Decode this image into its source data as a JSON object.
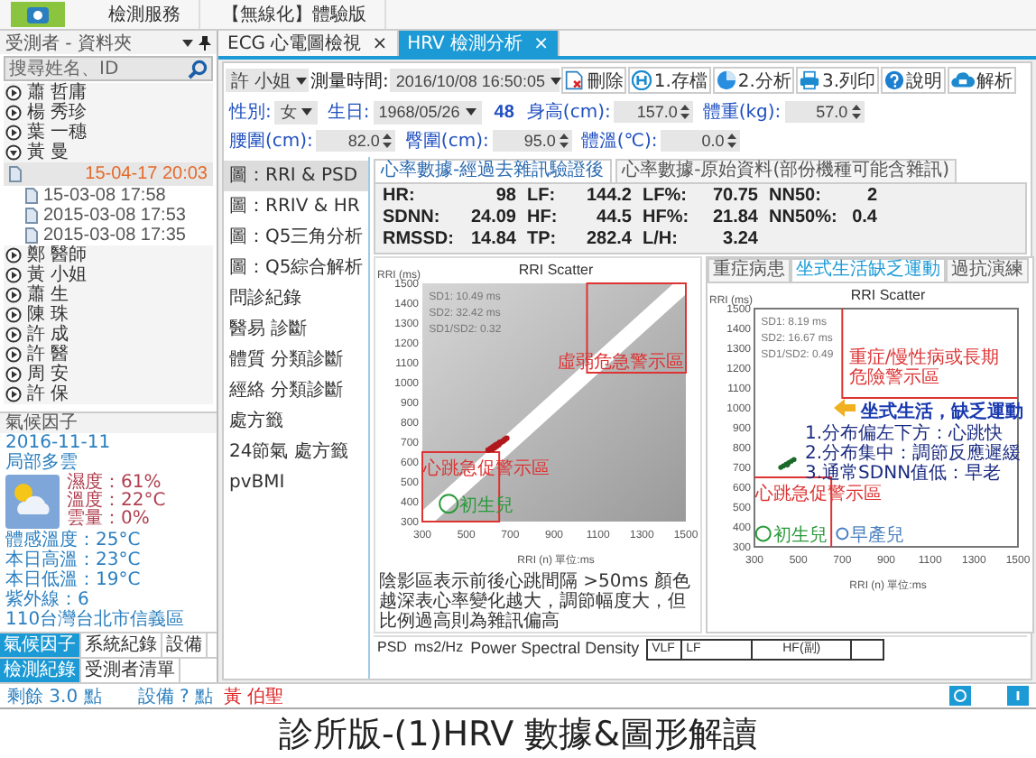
{
  "top_bar": {
    "tabs": [
      {
        "label": "檢測服務",
        "selected": false
      },
      {
        "label": "【無線化】體驗版",
        "selected": false
      }
    ]
  },
  "patient_panel": {
    "title": "受測者 - 資料夾",
    "search": {
      "placeholder": "搜尋姓名、ID"
    },
    "tree": [
      {
        "label": "蕭 哲庸",
        "expanded": false
      },
      {
        "label": "楊 秀珍",
        "expanded": false
      },
      {
        "label": "葉 一穗",
        "expanded": false
      },
      {
        "label": "黃 曼",
        "expanded": true,
        "children": [
          {
            "label": "15-04-17 20:03",
            "selected": true
          },
          {
            "label": "15-03-08 17:58",
            "selected": false
          },
          {
            "label": "2015-03-08 17:53",
            "selected": false
          },
          {
            "label": "2015-03-08 17:35",
            "selected": false
          }
        ]
      },
      {
        "label": "鄭 醫師",
        "expanded": false
      },
      {
        "label": "黃 小姐",
        "expanded": false
      },
      {
        "label": "蕭 生",
        "expanded": false
      },
      {
        "label": "陳 珠",
        "expanded": false
      },
      {
        "label": "許 成",
        "expanded": false
      },
      {
        "label": "許 醫",
        "expanded": false
      },
      {
        "label": "周 安",
        "expanded": false
      },
      {
        "label": "許 保",
        "expanded": false
      }
    ]
  },
  "weather": {
    "title": "氣候因子",
    "date": "2016-11-11",
    "condition": "局部多雲",
    "readings": [
      "濕度：61%",
      "溫度：22°C",
      "雲量：0%"
    ],
    "details": [
      "體感溫度：25°C",
      "本日高溫：23°C",
      "本日低溫：19°C",
      "紫外線：6"
    ],
    "location": "110台灣台北市信義區",
    "tabs": [
      {
        "label": "氣候因子",
        "selected": true
      },
      {
        "label": "系統紀錄",
        "selected": false
      },
      {
        "label": "設備",
        "selected": false
      }
    ]
  },
  "bottom_tabs": [
    {
      "label": "檢測紀錄",
      "selected": true
    },
    {
      "label": "受測者清單",
      "selected": false
    }
  ],
  "status_bar": {
    "points": "剩餘 3.0 點",
    "device": "設備 ? 點",
    "user": "黃 伯聖"
  },
  "doc_tabs": [
    {
      "label": "ECG 心電圖檢視",
      "close": "×",
      "selected": false
    },
    {
      "label": "HRV 檢測分析",
      "close": "×",
      "selected": true
    }
  ],
  "header": {
    "patient": "許 小姐",
    "time_label": "測量時間:",
    "time": "2016/10/08 16:50:05"
  },
  "actions": [
    {
      "label": "刪除",
      "kind": "delete"
    },
    {
      "label": "1.存檔",
      "kind": "save"
    },
    {
      "label": "2.分析",
      "kind": "analyze"
    },
    {
      "label": "3.列印",
      "kind": "print"
    },
    {
      "label": "說明",
      "kind": "help"
    },
    {
      "label": "解析",
      "kind": "cloud"
    }
  ],
  "profile": [
    {
      "label": "性別:",
      "value": "女",
      "kind": "select"
    },
    {
      "label": "生日:",
      "value": "1968/05/26",
      "kind": "select"
    },
    {
      "value": "48",
      "kind": "age"
    },
    {
      "label": "身高(cm):",
      "value": "157.0",
      "kind": "spin"
    },
    {
      "label": "體重(kg):",
      "value": "57.0",
      "kind": "spin"
    },
    {
      "label": "腰圍(cm):",
      "value": "82.0",
      "kind": "spin"
    },
    {
      "label": "臀圍(cm):",
      "value": "95.0",
      "kind": "spin"
    },
    {
      "label": "體溫(℃):",
      "value": "0.0",
      "kind": "spin"
    }
  ],
  "side_nav": [
    {
      "label": "圖：RRI & PSD",
      "selected": true
    },
    {
      "label": "圖：RRIV & HR",
      "selected": false
    },
    {
      "label": "圖：Q5三角分析",
      "selected": false
    },
    {
      "label": "圖：Q5綜合解析",
      "selected": false
    },
    {
      "label": "問診紀錄",
      "selected": false
    },
    {
      "label": "醫易 診斷",
      "selected": false
    },
    {
      "label": "體質 分類診斷",
      "selected": false
    },
    {
      "label": "經絡 分類診斷",
      "selected": false
    },
    {
      "label": "處方籤",
      "selected": false
    },
    {
      "label": "24節氣 處方籤",
      "selected": false
    },
    {
      "label": "pvBMI",
      "selected": false
    }
  ],
  "metrics": {
    "tabs": [
      {
        "label": "心率數據-經過去雜訊驗證後",
        "selected": true
      },
      {
        "label": "心率數據-原始資料(部份機種可能含雜訊)",
        "selected": false
      }
    ],
    "rows": [
      [
        {
          "label": "HR:",
          "value": "98"
        },
        {
          "label": "LF:",
          "value": "144.2"
        },
        {
          "label": "LF%:",
          "value": "70.75"
        },
        {
          "label": "NN50:",
          "value": "2"
        }
      ],
      [
        {
          "label": "SDNN:",
          "value": "24.09"
        },
        {
          "label": "HF:",
          "value": "44.5"
        },
        {
          "label": "HF%:",
          "value": "21.84"
        },
        {
          "label": "NN50%:",
          "value": "0.4"
        }
      ],
      [
        {
          "label": "RMSSD:",
          "value": "14.84"
        },
        {
          "label": "TP:",
          "value": "282.4"
        },
        {
          "label": "L/H:",
          "value": "3.24"
        }
      ]
    ]
  },
  "scatter_main": {
    "title": "RRI Scatter",
    "y_unit": "RRI (ms)",
    "x_unit": "RRI (n) 單位:ms",
    "stats": [
      "SD1:  10.49 ms",
      "SD2:  32.42 ms",
      "SD1/SD2: 0.32"
    ],
    "y_ticks": [
      "1500",
      "1400",
      "1300",
      "1200",
      "1100",
      "1000",
      "900",
      "800",
      "700",
      "600",
      "500",
      "400",
      "300"
    ],
    "x_ticks": [
      "300",
      "500",
      "700",
      "900",
      "1100",
      "1300",
      "1500"
    ],
    "zone_high": "虛弱危急警示區",
    "zone_low": "心跳急促警示區",
    "newborn": "初生兒",
    "note": "陰影區表示前後心跳間隔 >50ms 顏色越深表心率變化越大，調節幅度大，但比例過高則為雜訊偏高"
  },
  "scatter_compare": {
    "tabs": [
      {
        "label": "重症病患",
        "selected": false
      },
      {
        "label": "坐式生活缺乏運動",
        "selected": true
      },
      {
        "label": "過抗演練",
        "selected": false
      }
    ],
    "title": "RRI Scatter",
    "y_unit": "RRI (ms)",
    "x_unit": "RRI (n) 單位:ms",
    "stats": [
      "SD1:  8.19 ms",
      "SD2:  16.67 ms",
      "SD1/SD2: 0.49"
    ],
    "y_ticks": [
      "1500",
      "1400",
      "1300",
      "1200",
      "1100",
      "1000",
      "900",
      "800",
      "700",
      "600",
      "500",
      "400",
      "300"
    ],
    "x_ticks": [
      "300",
      "500",
      "700",
      "900",
      "1100",
      "1300",
      "1500"
    ],
    "zone_high": [
      "重症/慢性病或長期",
      "危險警示區"
    ],
    "zone_low": "心跳急促警示區",
    "newborn": "初生兒",
    "preterm": "早產兒",
    "callout": "坐式生活，缺乏運動",
    "findings": [
      "1.分布偏左下方：心跳快",
      "2.分布集中：調節反應遲緩",
      "3.通常SDNN值低：早老"
    ]
  },
  "psd": {
    "title": "Power Spectral Density",
    "y_label": "PSD",
    "unit": "ms2/Hz",
    "bands": [
      "VLF",
      "LF",
      "HF(副)"
    ]
  },
  "caption": "診所版-(1)HRV 數據&圖形解讀"
}
